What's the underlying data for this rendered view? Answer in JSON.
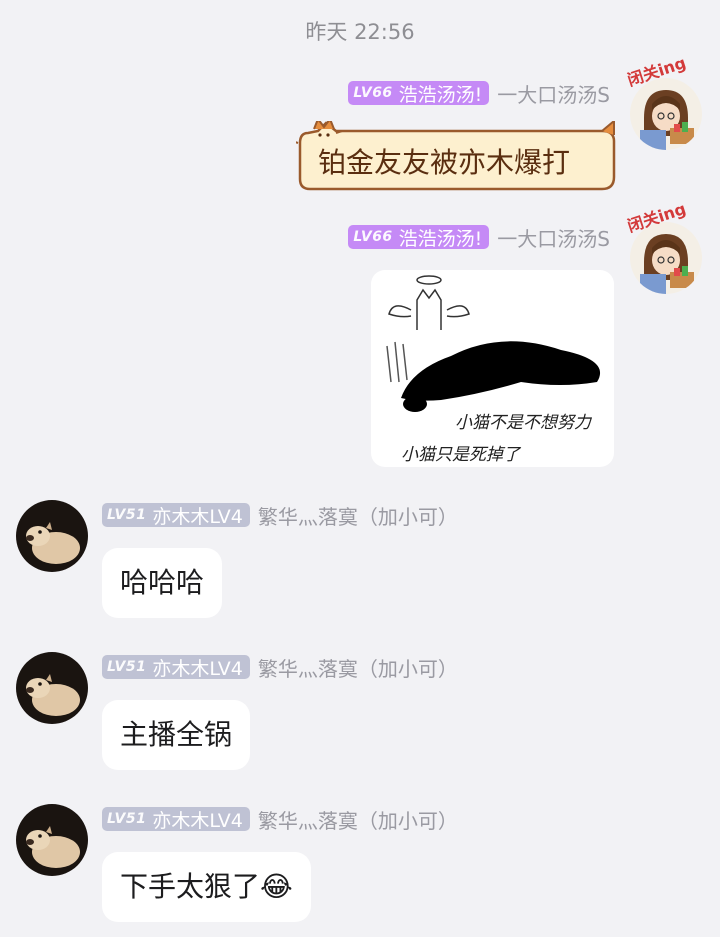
{
  "chat": {
    "timestamp": "昨天 22:56",
    "messages": [
      {
        "level": "LV66",
        "nickname": "浩浩汤汤!",
        "fan_name": "一大口汤汤S",
        "avatar_caption": "闭关ing",
        "text": "铂金友友被亦木爆打"
      },
      {
        "level": "LV66",
        "nickname": "浩浩汤汤!",
        "fan_name": "一大口汤汤S",
        "avatar_caption": "闭关ing",
        "sticker_line1": "小猫不是不想努力",
        "sticker_line2": "小猫只是死掉了"
      },
      {
        "level": "LV51",
        "nickname": "亦木木LV4",
        "fan_name": "繁华灬落寞（加小可）",
        "text": "哈哈哈"
      },
      {
        "level": "LV51",
        "nickname": "亦木木LV4",
        "fan_name": "繁华灬落寞（加小可）",
        "text": "主播全锅"
      },
      {
        "level": "LV51",
        "nickname": "亦木木LV4",
        "fan_name": "繁华灬落寞（加小可）",
        "text": "下手太狠了😂"
      }
    ]
  },
  "colors": {
    "background": "#f2f2f5",
    "badge_purple": "#c58af6",
    "badge_gray": "#bfc2d4",
    "cat_bubble_fill": "#fdf0cf",
    "cat_bubble_border": "#9a5a2c"
  }
}
